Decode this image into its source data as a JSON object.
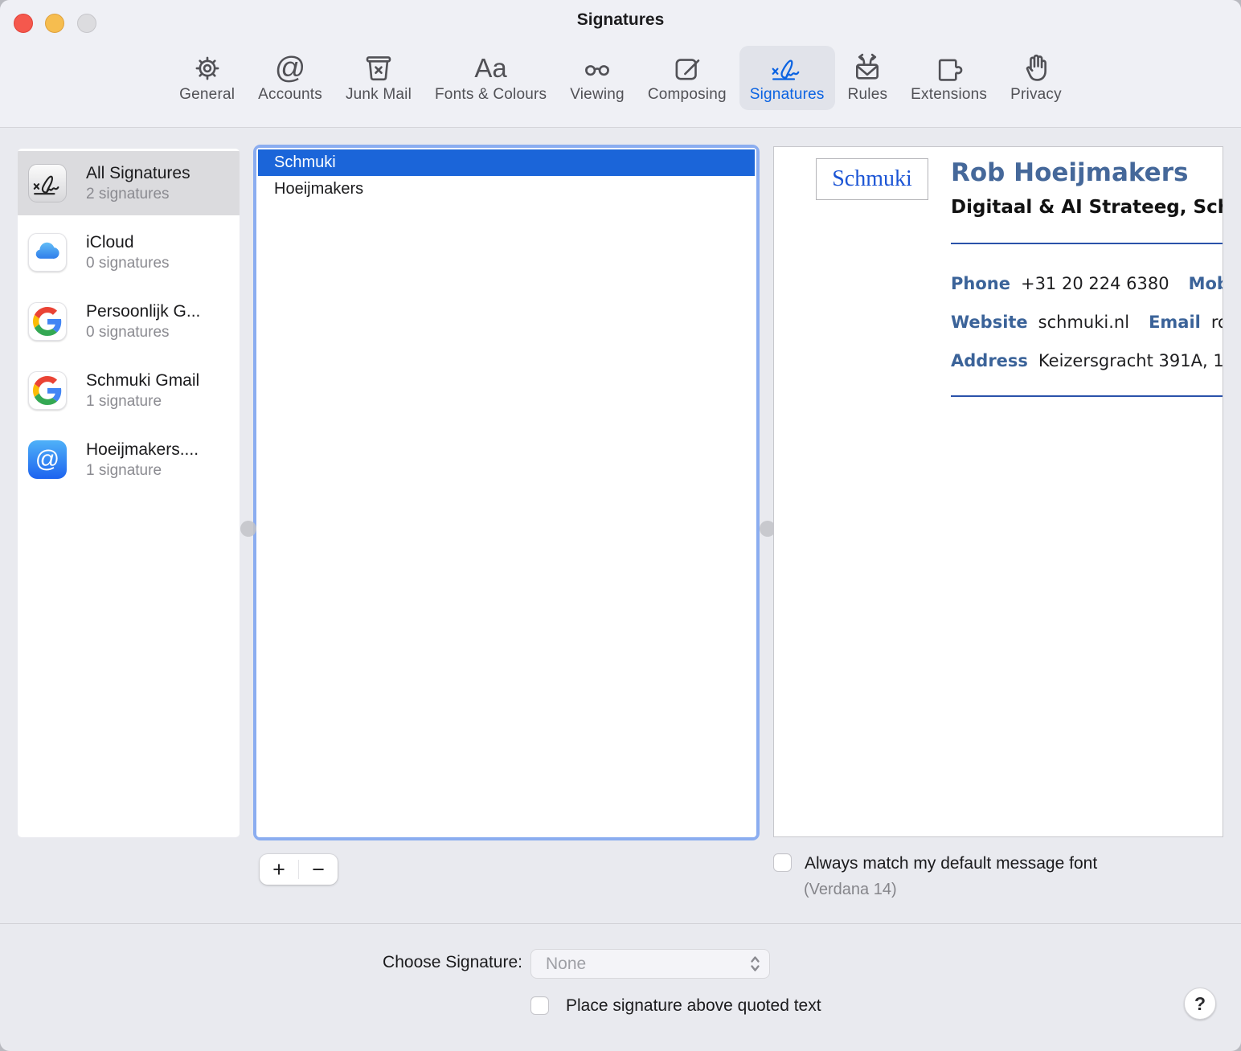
{
  "window": {
    "title": "Signatures"
  },
  "toolbar": {
    "tabs": [
      {
        "label": "General"
      },
      {
        "label": "Accounts"
      },
      {
        "label": "Junk Mail"
      },
      {
        "label": "Fonts & Colours"
      },
      {
        "label": "Viewing"
      },
      {
        "label": "Composing"
      },
      {
        "label": "Signatures",
        "selected": true
      },
      {
        "label": "Rules"
      },
      {
        "label": "Extensions"
      },
      {
        "label": "Privacy"
      }
    ],
    "glyphs": {
      "accounts": "@",
      "fonts": "Aa"
    }
  },
  "sidebar": {
    "items": [
      {
        "name": "All Signatures",
        "count": "2 signatures",
        "selected": true
      },
      {
        "name": "iCloud",
        "count": "0 signatures"
      },
      {
        "name": "Persoonlijk G...",
        "count": "0 signatures"
      },
      {
        "name": "Schmuki Gmail",
        "count": "1 signature"
      },
      {
        "name": "Hoeijmakers....",
        "count": "1 signature"
      }
    ],
    "at_badge_glyph": "@"
  },
  "signature_list": {
    "items": [
      {
        "name": "Schmuki",
        "selected": true
      },
      {
        "name": "Hoeijmakers",
        "selected": false
      }
    ]
  },
  "preview": {
    "logo_text": "Schmuki",
    "name": "Rob Hoeijmakers",
    "role": "Digitaal & AI Strateeg, Sch",
    "contact": {
      "phone_label": "Phone",
      "phone_value": "+31 20 224 6380",
      "mobile_label": "Mob",
      "website_label": "Website",
      "website_value": "schmuki.nl",
      "email_label": "Email",
      "email_value": "ro",
      "address_label": "Address",
      "address_value": "Keizersgracht 391A, 1"
    }
  },
  "controls": {
    "add_label": "+",
    "remove_label": "−",
    "match_font_label": "Always match my default message font",
    "match_font_sub": "(Verdana 14)",
    "match_font_checked": false
  },
  "footer": {
    "choose_signature_label": "Choose Signature:",
    "choose_signature_value": "None",
    "place_above_label": "Place signature above quoted text",
    "place_above_checked": false,
    "help_label": "?"
  },
  "colors": {
    "accent": "#1b65d9",
    "focus_ring": "#8badf0",
    "tab_selected": "#0b63e2",
    "preview_label_blue": "#3b6399",
    "preview_name_blue": "#45689a",
    "logo_blue": "#1c55d5",
    "rule_blue": "#2a52aa"
  }
}
